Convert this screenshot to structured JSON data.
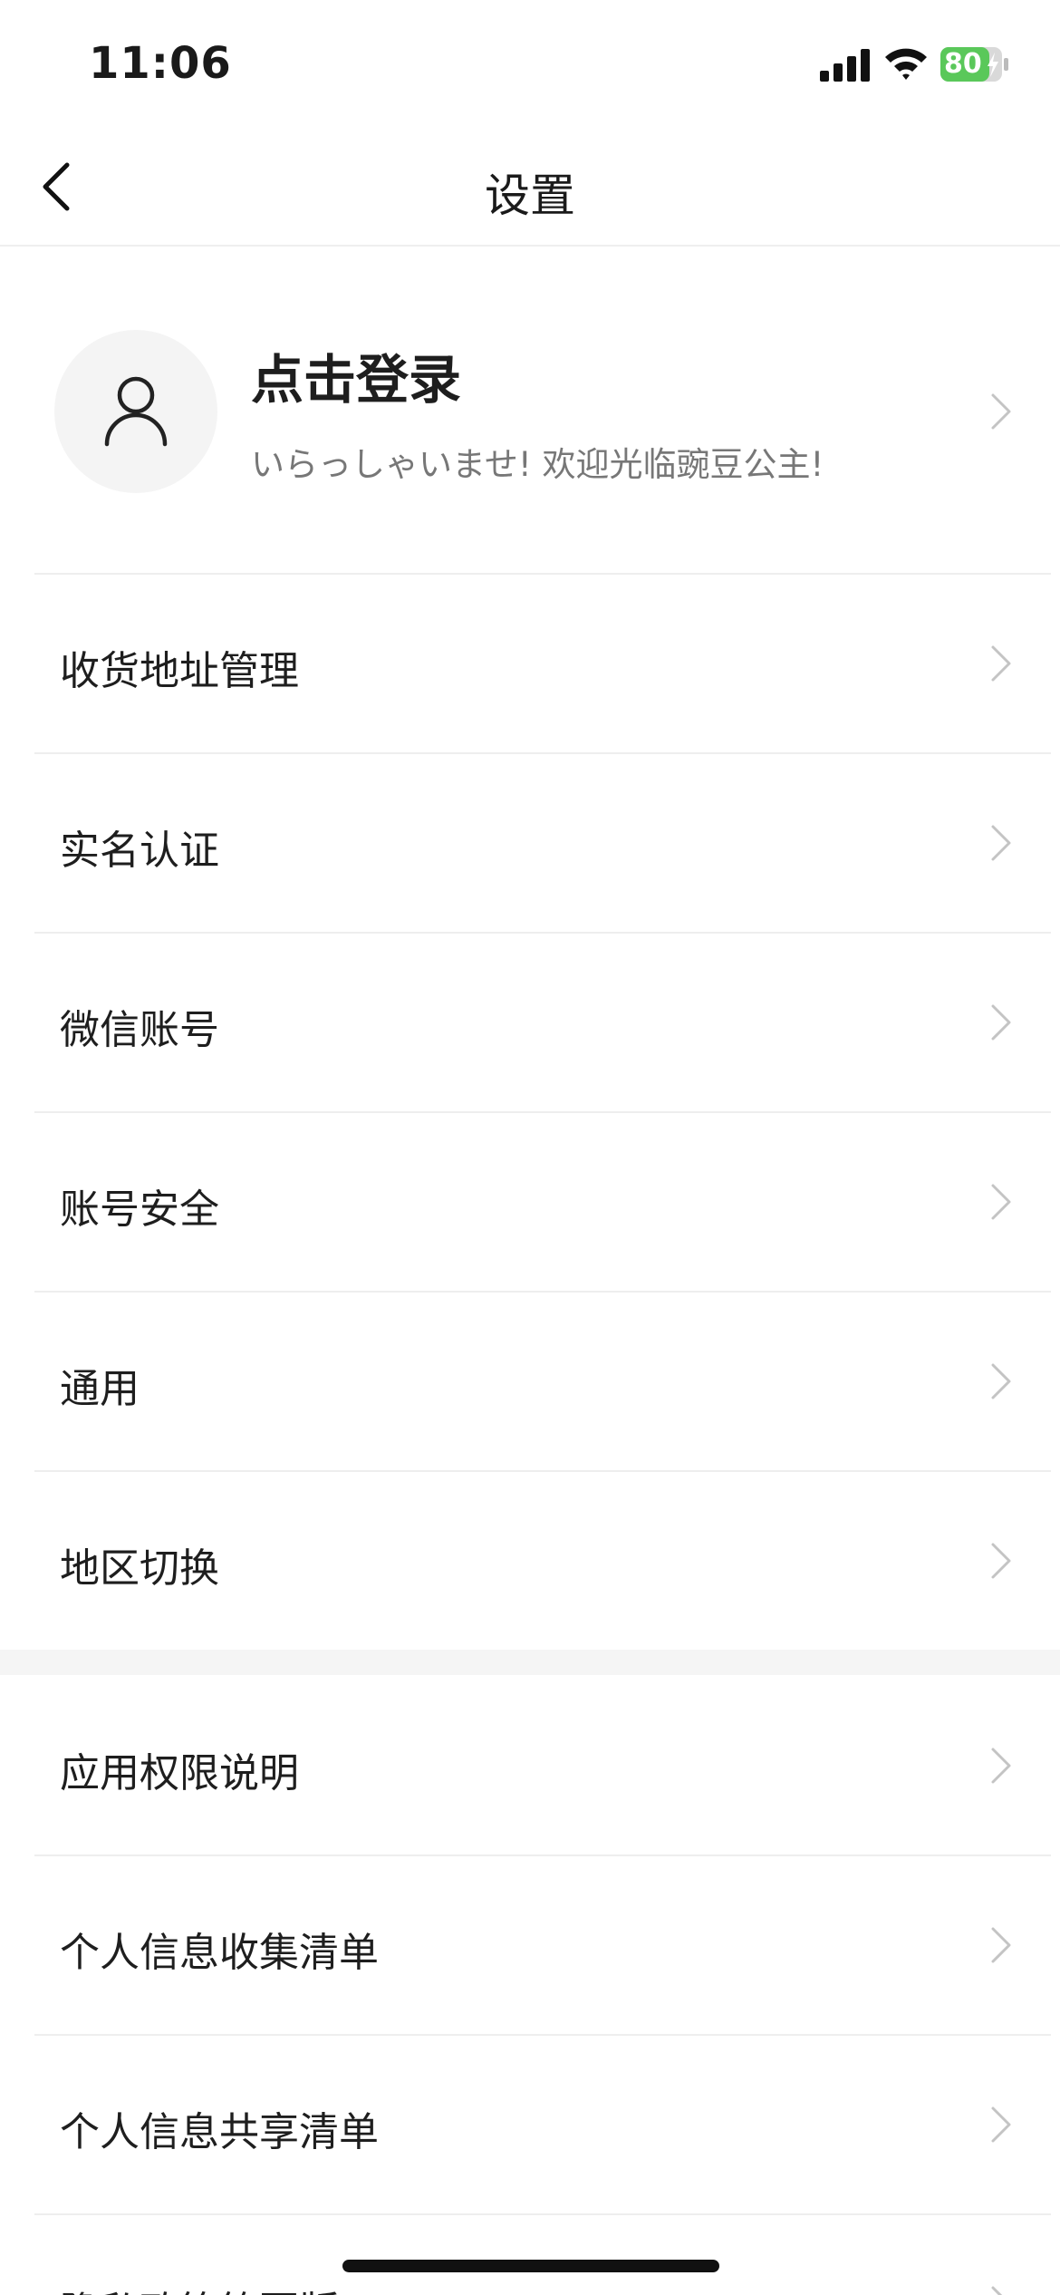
{
  "status_bar": {
    "time": "11:06",
    "battery": "80",
    "battery_color": "#5ac85a"
  },
  "nav": {
    "title": "设置"
  },
  "profile": {
    "title": "点击登录",
    "subtitle": "いらっしゃいませ! 欢迎光临豌豆公主!"
  },
  "menu": {
    "address": "收货地址管理",
    "realname": "实名认证",
    "wechat": "微信账号",
    "security": "账号安全",
    "general": "通用",
    "region": "地区切换",
    "permissions": "应用权限说明",
    "info_collection": "个人信息收集清单",
    "info_sharing": "个人信息共享清单",
    "privacy_summary": "隐私政策简要版"
  },
  "icons": {
    "back": "chevron-left-icon",
    "row": "chevron-right-icon",
    "avatar": "user-icon"
  }
}
